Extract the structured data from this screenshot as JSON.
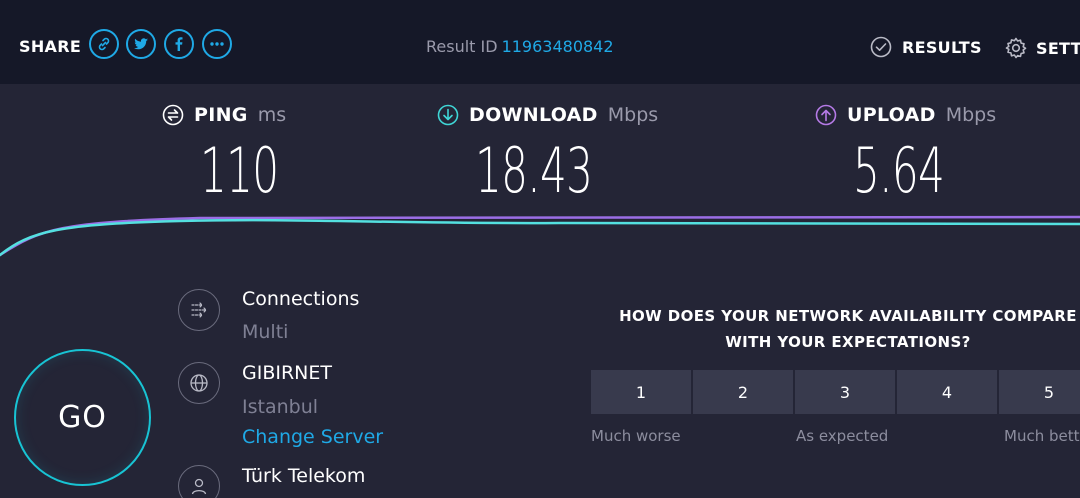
{
  "header": {
    "share_label": "SHARE",
    "share_buttons": [
      {
        "icon": "link-icon"
      },
      {
        "icon": "twitter-icon"
      },
      {
        "icon": "facebook-icon"
      },
      {
        "icon": "more-icon"
      }
    ],
    "result_id_label": "Result ID",
    "result_id": "11963480842",
    "results_label": "RESULTS",
    "settings_label": "SETTINGS"
  },
  "metrics": {
    "ping": {
      "name": "PING",
      "unit": "ms",
      "value": "110"
    },
    "download": {
      "name": "DOWNLOAD",
      "unit": "Mbps",
      "value": "18.43"
    },
    "upload": {
      "name": "UPLOAD",
      "unit": "Mbps",
      "value": "5.64"
    }
  },
  "go_label": "GO",
  "server_info": {
    "connections_title": "Connections",
    "connections_value": "Multi",
    "host_name": "GIBIRNET",
    "host_location": "Istanbul",
    "change_server": "Change Server",
    "isp_name": "Türk Telekom"
  },
  "survey": {
    "question_line1": "HOW DOES YOUR NETWORK AVAILABILITY COMPARE",
    "question_line2": "WITH YOUR EXPECTATIONS?",
    "options": [
      "1",
      "2",
      "3",
      "4",
      "5"
    ],
    "label_low": "Much worse",
    "label_mid": "As expected",
    "label_high": "Much better"
  },
  "colors": {
    "accent": "#1fa9e6",
    "download": "#3fd6d6",
    "upload": "#b57ae6",
    "background": "#242536",
    "topbar": "#151828"
  }
}
